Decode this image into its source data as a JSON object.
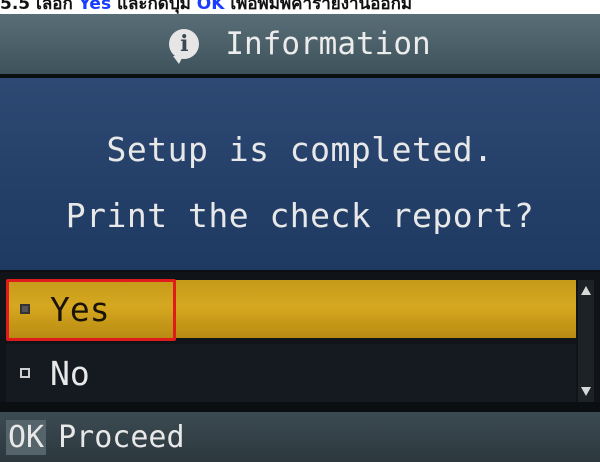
{
  "caption": {
    "prefix": "5.5 เลือก ",
    "yes": "Yes",
    "middle": " และกดปุ่ม ",
    "ok": "OK",
    "suffix": " เพื่อพิมพ์ค่ารายงานออกม"
  },
  "dialog": {
    "title": "Information",
    "icon": "speech-bubble-info-icon",
    "message_line1": "Setup is completed.",
    "message_line2": "Print the check report?"
  },
  "options": [
    {
      "label": "Yes",
      "selected": true
    },
    {
      "label": "No",
      "selected": false
    }
  ],
  "footer": {
    "key": "OK",
    "action": "Proceed"
  },
  "colors": {
    "highlight": "#d6a820",
    "annotation_box": "#e01b1b",
    "content_bg": "#2a456e",
    "caption_accent": "#1a3cff"
  }
}
